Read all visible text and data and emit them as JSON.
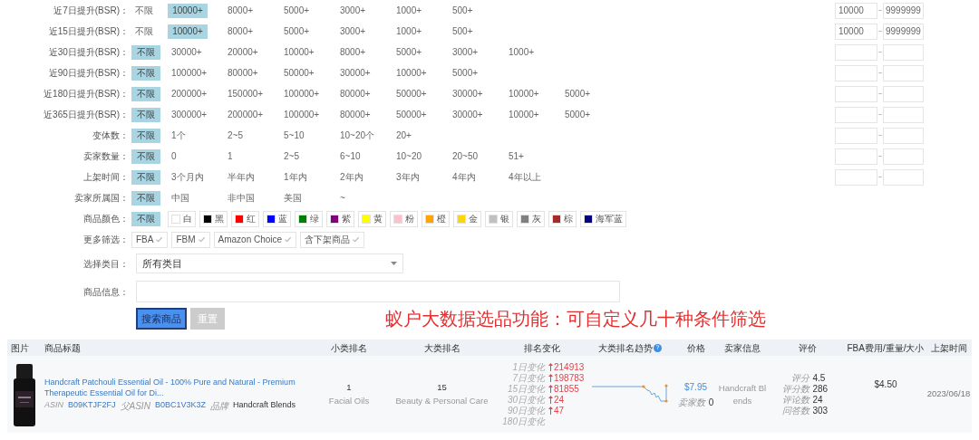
{
  "filters": [
    {
      "kind": "options",
      "label": "近7日提升(BSR)：",
      "options": [
        {
          "text": "不限",
          "selected": false
        },
        {
          "text": "10000+",
          "selected": true
        },
        {
          "text": "8000+",
          "selected": false
        },
        {
          "text": "5000+",
          "selected": false
        },
        {
          "text": "3000+",
          "selected": false
        },
        {
          "text": "1000+",
          "selected": false
        },
        {
          "text": "500+",
          "selected": false
        }
      ],
      "range": {
        "min": "10000",
        "separator": "~",
        "max": "9999999"
      }
    },
    {
      "kind": "options",
      "label": "近15日提升(BSR)：",
      "options": [
        {
          "text": "不限",
          "selected": false
        },
        {
          "text": "10000+",
          "selected": true
        },
        {
          "text": "8000+",
          "selected": false
        },
        {
          "text": "5000+",
          "selected": false
        },
        {
          "text": "3000+",
          "selected": false
        },
        {
          "text": "1000+",
          "selected": false
        },
        {
          "text": "500+",
          "selected": false
        }
      ],
      "range": {
        "min": "10000",
        "separator": "~",
        "max": "9999999"
      }
    },
    {
      "kind": "options",
      "label": "近30日提升(BSR)：",
      "options": [
        {
          "text": "不限",
          "selected": true
        },
        {
          "text": "30000+",
          "selected": false
        },
        {
          "text": "20000+",
          "selected": false
        },
        {
          "text": "10000+",
          "selected": false
        },
        {
          "text": "8000+",
          "selected": false
        },
        {
          "text": "5000+",
          "selected": false
        },
        {
          "text": "3000+",
          "selected": false
        },
        {
          "text": "1000+",
          "selected": false
        }
      ],
      "range": {
        "separator": "~"
      }
    },
    {
      "kind": "options",
      "label": "近90日提升(BSR)：",
      "options": [
        {
          "text": "不限",
          "selected": true
        },
        {
          "text": "100000+",
          "selected": false
        },
        {
          "text": "80000+",
          "selected": false
        },
        {
          "text": "50000+",
          "selected": false
        },
        {
          "text": "30000+",
          "selected": false
        },
        {
          "text": "10000+",
          "selected": false
        },
        {
          "text": "5000+",
          "selected": false
        }
      ],
      "range": {
        "separator": "~"
      }
    },
    {
      "kind": "options",
      "label": "近180日提升(BSR)：",
      "options": [
        {
          "text": "不限",
          "selected": true
        },
        {
          "text": "200000+",
          "selected": false
        },
        {
          "text": "150000+",
          "selected": false
        },
        {
          "text": "100000+",
          "selected": false
        },
        {
          "text": "80000+",
          "selected": false
        },
        {
          "text": "50000+",
          "selected": false
        },
        {
          "text": "30000+",
          "selected": false
        },
        {
          "text": "10000+",
          "selected": false
        },
        {
          "text": "5000+",
          "selected": false
        }
      ],
      "range": {
        "separator": "~"
      }
    },
    {
      "kind": "options",
      "label": "近365日提升(BSR)：",
      "options": [
        {
          "text": "不限",
          "selected": true
        },
        {
          "text": "300000+",
          "selected": false
        },
        {
          "text": "200000+",
          "selected": false
        },
        {
          "text": "100000+",
          "selected": false
        },
        {
          "text": "80000+",
          "selected": false
        },
        {
          "text": "50000+",
          "selected": false
        },
        {
          "text": "30000+",
          "selected": false
        },
        {
          "text": "10000+",
          "selected": false
        },
        {
          "text": "5000+",
          "selected": false
        }
      ],
      "range": {
        "separator": "~"
      }
    },
    {
      "kind": "options",
      "label": "变体数：",
      "options": [
        {
          "text": "不限",
          "selected": true
        },
        {
          "text": "1个",
          "selected": false
        },
        {
          "text": "2~5",
          "selected": false
        },
        {
          "text": "5~10",
          "selected": false
        },
        {
          "text": "10~20个",
          "selected": false
        },
        {
          "text": "20+",
          "selected": false
        }
      ],
      "range": {
        "separator": "~"
      }
    },
    {
      "kind": "options",
      "label": "卖家数量：",
      "options": [
        {
          "text": "不限",
          "selected": true
        },
        {
          "text": "0",
          "selected": false
        },
        {
          "text": "1",
          "selected": false
        },
        {
          "text": "2~5",
          "selected": false
        },
        {
          "text": "6~10",
          "selected": false
        },
        {
          "text": "10~20",
          "selected": false
        },
        {
          "text": "20~50",
          "selected": false
        },
        {
          "text": "51+",
          "selected": false
        }
      ],
      "range": {
        "separator": "~"
      }
    },
    {
      "kind": "options",
      "label": "上架时间：",
      "options": [
        {
          "text": "不限",
          "selected": true
        },
        {
          "text": "3个月内",
          "selected": false
        },
        {
          "text": "半年内",
          "selected": false
        },
        {
          "text": "1年内",
          "selected": false
        },
        {
          "text": "2年内",
          "selected": false
        },
        {
          "text": "3年内",
          "selected": false
        },
        {
          "text": "4年内",
          "selected": false
        },
        {
          "text": "4年以上",
          "selected": false
        }
      ],
      "range": {
        "separator": "~"
      }
    },
    {
      "kind": "options",
      "label": "卖家所属国：",
      "options": [
        {
          "text": "不限",
          "selected": true
        },
        {
          "text": "中国",
          "selected": false
        },
        {
          "text": "非中国",
          "selected": false
        },
        {
          "text": "美国",
          "selected": false
        },
        {
          "text": "~",
          "selected": false
        }
      ]
    },
    {
      "kind": "colors",
      "label": "商品颜色：",
      "options": [
        {
          "text": "不限",
          "selected": true
        },
        {
          "text": "白",
          "color": "#ffffff",
          "selected": false
        },
        {
          "text": "黑",
          "color": "#000000",
          "selected": false
        },
        {
          "text": "红",
          "color": "#ff0000",
          "selected": false
        },
        {
          "text": "蓝",
          "color": "#0000ff",
          "selected": false
        },
        {
          "text": "绿",
          "color": "#008000",
          "selected": false
        },
        {
          "text": "紫",
          "color": "#800080",
          "selected": false
        },
        {
          "text": "黄",
          "color": "#ffff00",
          "selected": false
        },
        {
          "text": "粉",
          "color": "#ffc0cb",
          "selected": false
        },
        {
          "text": "橙",
          "color": "#ffa500",
          "selected": false
        },
        {
          "text": "金",
          "color": "#ffd700",
          "selected": false
        },
        {
          "text": "银",
          "color": "#c0c0c0",
          "selected": false
        },
        {
          "text": "灰",
          "color": "#808080",
          "selected": false
        },
        {
          "text": "棕",
          "color": "#a52a2a",
          "selected": false
        },
        {
          "text": "海军蓝",
          "color": "#000080",
          "selected": false
        }
      ]
    },
    {
      "kind": "checks",
      "label": "更多筛选：",
      "options": [
        {
          "text": "FBA",
          "checked": false
        },
        {
          "text": "FBM",
          "checked": false
        },
        {
          "text": "Amazon Choice",
          "checked": false
        },
        {
          "text": "含下架商品",
          "checked": false
        }
      ]
    }
  ],
  "category": {
    "label": "选择类目：",
    "value": "所有类目"
  },
  "info": {
    "label": "商品信息："
  },
  "buttons": [
    {
      "label": "搜索商品",
      "kind": "primary"
    },
    {
      "label": "重置",
      "kind": "secondary"
    }
  ],
  "promo_text": "蚁户大数据选品功能：可自定义几十种条件筛选",
  "table": {
    "columns": [
      {
        "label": "图片"
      },
      {
        "label": "商品标题"
      },
      {
        "label": "小类排名"
      },
      {
        "label": "大类排名"
      },
      {
        "label": "排名变化"
      },
      {
        "label": "大类排名趋势",
        "help": "?"
      },
      {
        "label": "价格"
      },
      {
        "label": "卖家信息"
      },
      {
        "label": "评价"
      },
      {
        "label": "FBA费用/重量/大小"
      },
      {
        "label": "上架时间"
      }
    ],
    "rows": [
      {
        "title": "Handcraft Patchouli Essential Oil - 100% Pure and Natural - Premium Therapeutic Essential Oil for Di...",
        "asin_label": "ASIN",
        "asin": "B09KTJF2FJ",
        "parent_asin_label": "父ASIN",
        "parent_asin": "B0BC1V3K3Z",
        "brand_label": "品牌",
        "brand": "Handcraft Blends",
        "sub_rank": "1",
        "sub_category": "Facial Oils",
        "main_rank": "15",
        "main_category": "Beauty & Personal Care",
        "rank_changes": [
          {
            "label": "1日变化",
            "value": "214913"
          },
          {
            "label": "7日变化",
            "value": "198783"
          },
          {
            "label": "15日变化",
            "value": "81855"
          },
          {
            "label": "30日变化",
            "value": "24"
          },
          {
            "label": "90日变化",
            "value": "47"
          },
          {
            "label": "180日变化"
          }
        ],
        "price": "$7.95",
        "sellers_label": "卖家数",
        "sellers": "0",
        "seller_info": "Handcraft Blends",
        "ratings": [
          {
            "label": "评分",
            "value": "4.5"
          },
          {
            "label": "评分数",
            "value": "286"
          },
          {
            "label": "评论数",
            "value": "24"
          },
          {
            "label": "问答数",
            "value": "303"
          }
        ],
        "fba_fee": "$4.50",
        "listed": "2023/06/18"
      }
    ]
  }
}
